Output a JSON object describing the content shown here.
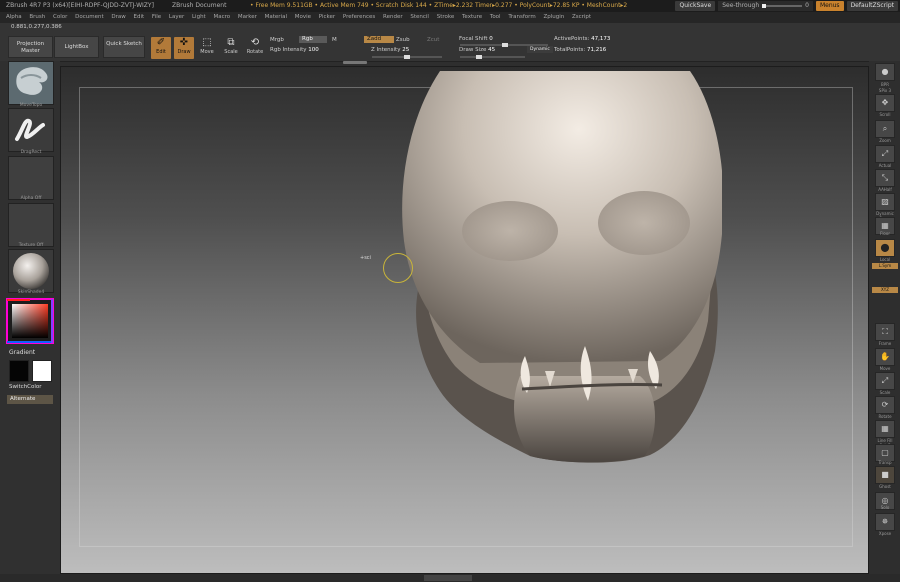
{
  "titlebar": {
    "title": "ZBrush 4R7 P3 (x64)[EIHI-RDPF-QJDD-ZVTJ-WIZY]",
    "document": "ZBrush Document",
    "stats": "• Free Mem 9.511GB • Active Mem 749 • Scratch Disk 144 • ZTime▸2.232 Timer▸0.277 • PolyCount▸72.85 KP • MeshCount▸2",
    "quicksave": "QuickSave",
    "seethrough_label": "See-through",
    "seethrough_value": "0",
    "menus": "Menus",
    "script": "DefaultZScript"
  },
  "menubar": [
    "Alpha",
    "Brush",
    "Color",
    "Document",
    "Draw",
    "Edit",
    "File",
    "Layer",
    "Light",
    "Macro",
    "Marker",
    "Material",
    "Movie",
    "Picker",
    "Preferences",
    "Render",
    "Stencil",
    "Stroke",
    "Texture",
    "Tool",
    "Transform",
    "Zplugin",
    "Zscript"
  ],
  "toolbar": {
    "coords": "0.881,0.277,0.386",
    "projection_master": "Projection Master",
    "lightbox": "LightBox",
    "quick_sketch": "Quick Sketch",
    "edit": "Edit",
    "draw": "Draw",
    "move": "Move",
    "scale": "Scale",
    "rotate": "Rotate",
    "mrgb": "Mrgb",
    "rgb": "Rgb",
    "m": "M",
    "rgb_intensity_label": "Rgb Intensity",
    "rgb_intensity_value": "100",
    "zadd": "Zadd",
    "zsub": "Zsub",
    "zcut": "Zcut",
    "z_intensity_label": "Z Intensity",
    "z_intensity_value": "25",
    "focal_shift_label": "Focal Shift",
    "focal_shift_value": "0",
    "draw_size_label": "Draw Size",
    "draw_size_value": "45",
    "dynamic": "Dynamic",
    "active_points_label": "ActivePoints:",
    "active_points_value": "47,173",
    "total_points_label": "TotalPoints:",
    "total_points_value": "71,216"
  },
  "leftpanel": {
    "brush_label": "MoveTopo",
    "stroke_label": "DragRect",
    "alpha_label": "Alpha Off",
    "texture_label": "Texture Off",
    "material_label": "SkinShade4",
    "gradient": "Gradient",
    "switchcolor": "SwitchColor",
    "alternate": "Alternate"
  },
  "rightpanel": [
    "BPR",
    "SPix 3",
    "Scroll",
    "Zoom",
    "Actual",
    "AAHalf",
    "Dynamic Persp",
    "Floor",
    "Local",
    "L.Sym",
    "XYZ",
    "Frame",
    "Move",
    "Scale",
    "Rotate",
    "Line Fill PolyF",
    "Transp",
    "Ghost",
    "Solo",
    "Xpose"
  ],
  "canvas": {
    "cursor_label": "+sci"
  },
  "colors": {
    "accent": "#b88846",
    "menus": "#c9822d"
  }
}
